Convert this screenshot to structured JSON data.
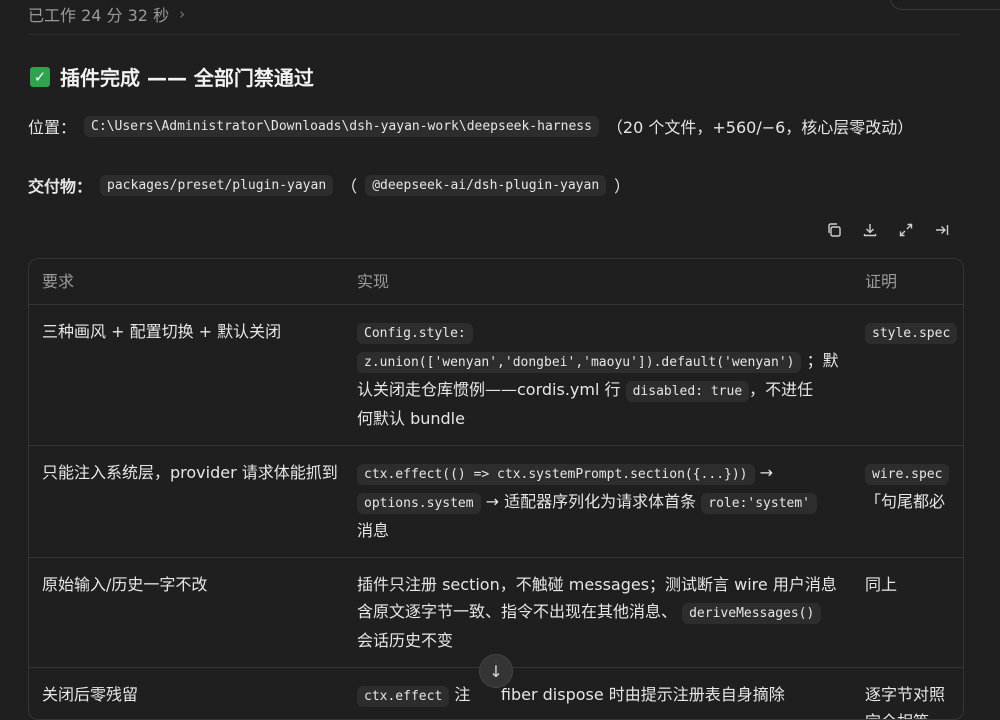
{
  "header": {
    "status_text": "已工作 24 分 32 秒",
    "chevron": "›"
  },
  "heading": {
    "check_icon": "✓",
    "title": "插件完成 —— 全部门禁通过"
  },
  "location": {
    "label": "位置：",
    "path": "C:\\Users\\Administrator\\Downloads\\dsh-yayan-work\\deepseek-harness",
    "summary": "（20 个文件，+560/−6，核心层零改动）"
  },
  "deliverable": {
    "label": "交付物：",
    "package_path": "packages/preset/plugin-yayan",
    "open_paren": "（",
    "package_name": "@deepseek-ai/dsh-plugin-yayan",
    "close_paren": "）"
  },
  "toolbar": {
    "icons": [
      "copy-icon",
      "download-icon",
      "expand-icon",
      "collapse-icon"
    ]
  },
  "table": {
    "headers": [
      "要求",
      "实现",
      "证明"
    ],
    "rows": [
      {
        "req": "三种画风 + 配置切换 + 默认关闭",
        "impl": {
          "code1": "Config.style:",
          "code2": "z.union(['wenyan','dongbei','maoyu']).default('wenyan')",
          "text1": "；默",
          "text2": "认关闭走仓库惯例——cordis.yml 行",
          "code3": "disabled: true",
          "text3": "，不进任",
          "text4": "何默认 bundle"
        },
        "proof": "style.spec"
      },
      {
        "req": "只能注入系统层，provider 请求体能抓到",
        "impl": {
          "code1": "ctx.effect(() => ctx.systemPrompt.section({...}))",
          "text1": "→",
          "code2": "options.system",
          "text2": "→ 适配器序列化为请求体首条",
          "code3": "role:'system'",
          "text3": "消息"
        },
        "proof": "wire.spec",
        "proof2": "「句尾都必"
      },
      {
        "req": "原始输入/历史一字不改",
        "impl": {
          "text1": "插件只注册 section，不触碰 messages；测试断言 wire 用户消息",
          "text2": "含原文逐字节一致、指令不出现在其他消息、",
          "code1": "deriveMessages()",
          "text3": "会话历史不变"
        },
        "proof": "同上"
      },
      {
        "req": "关闭后零残留",
        "impl": {
          "code1": "ctx.effect",
          "text1": "注",
          "text2": "fiber dispose 时由提示注册表自身摘除"
        },
        "proof": "逐字节对照",
        "proof2": "完全相等"
      }
    ]
  },
  "scroll": {
    "arrow": "↓"
  }
}
